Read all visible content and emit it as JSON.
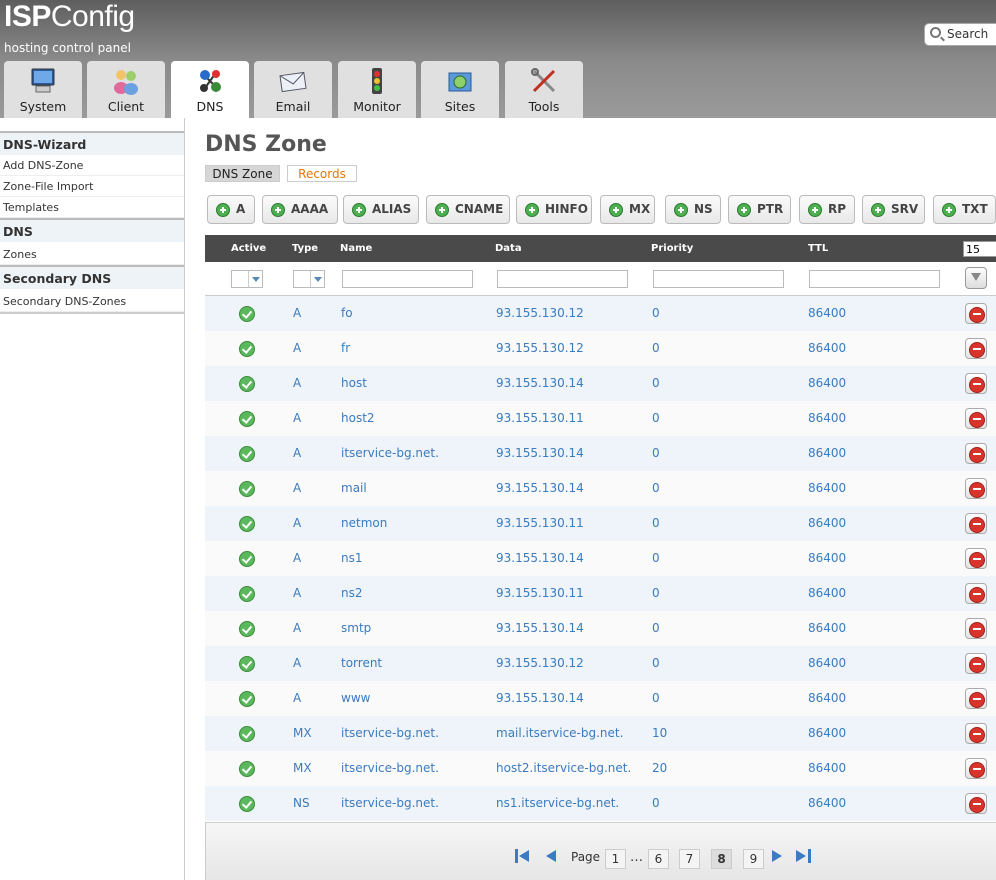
{
  "app": {
    "logo_isp": "ISP",
    "logo_config": "Config",
    "tagline": "hosting control panel",
    "search_label": "Search"
  },
  "tabs": [
    {
      "label": "System",
      "icon": "computer-icon"
    },
    {
      "label": "Client",
      "icon": "users-icon"
    },
    {
      "label": "DNS",
      "icon": "dns-network-icon",
      "active": true
    },
    {
      "label": "Email",
      "icon": "envelope-icon"
    },
    {
      "label": "Monitor",
      "icon": "traffic-light-icon"
    },
    {
      "label": "Sites",
      "icon": "globe-folder-icon"
    },
    {
      "label": "Tools",
      "icon": "tools-icon"
    }
  ],
  "sidebar": {
    "wizard_head": "DNS-Wizard",
    "wizard_items": [
      "Add DNS-Zone",
      "Zone-File Import",
      "Templates"
    ],
    "dns_head": "DNS",
    "dns_items": [
      "Zones"
    ],
    "secondary_head": "Secondary DNS",
    "secondary_items": [
      "Secondary DNS-Zones"
    ]
  },
  "page": {
    "title": "DNS Zone",
    "subtab_zone": "DNS Zone",
    "subtab_records": "Records"
  },
  "add_buttons": [
    "A",
    "AAAA",
    "ALIAS",
    "CNAME",
    "HINFO",
    "MX",
    "NS",
    "PTR",
    "RP",
    "SRV",
    "TXT"
  ],
  "table": {
    "headers": {
      "active": "Active",
      "type": "Type",
      "name": "Name",
      "data": "Data",
      "priority": "Priority",
      "ttl": "TTL"
    },
    "per_page": "15",
    "rows": [
      {
        "type": "A",
        "name": "fo",
        "data": "93.155.130.12",
        "priority": "0",
        "ttl": "86400"
      },
      {
        "type": "A",
        "name": "fr",
        "data": "93.155.130.12",
        "priority": "0",
        "ttl": "86400"
      },
      {
        "type": "A",
        "name": "host",
        "data": "93.155.130.14",
        "priority": "0",
        "ttl": "86400"
      },
      {
        "type": "A",
        "name": "host2",
        "data": "93.155.130.11",
        "priority": "0",
        "ttl": "86400"
      },
      {
        "type": "A",
        "name": "itservice-bg.net.",
        "data": "93.155.130.14",
        "priority": "0",
        "ttl": "86400"
      },
      {
        "type": "A",
        "name": "mail",
        "data": "93.155.130.14",
        "priority": "0",
        "ttl": "86400"
      },
      {
        "type": "A",
        "name": "netmon",
        "data": "93.155.130.11",
        "priority": "0",
        "ttl": "86400"
      },
      {
        "type": "A",
        "name": "ns1",
        "data": "93.155.130.14",
        "priority": "0",
        "ttl": "86400"
      },
      {
        "type": "A",
        "name": "ns2",
        "data": "93.155.130.11",
        "priority": "0",
        "ttl": "86400"
      },
      {
        "type": "A",
        "name": "smtp",
        "data": "93.155.130.14",
        "priority": "0",
        "ttl": "86400"
      },
      {
        "type": "A",
        "name": "torrent",
        "data": "93.155.130.12",
        "priority": "0",
        "ttl": "86400"
      },
      {
        "type": "A",
        "name": "www",
        "data": "93.155.130.14",
        "priority": "0",
        "ttl": "86400"
      },
      {
        "type": "MX",
        "name": "itservice-bg.net.",
        "data": "mail.itservice-bg.net.",
        "priority": "10",
        "ttl": "86400"
      },
      {
        "type": "MX",
        "name": "itservice-bg.net.",
        "data": "host2.itservice-bg.net.",
        "priority": "20",
        "ttl": "86400"
      },
      {
        "type": "NS",
        "name": "itservice-bg.net.",
        "data": "ns1.itservice-bg.net.",
        "priority": "0",
        "ttl": "86400"
      }
    ]
  },
  "pager": {
    "label": "Page",
    "pages": [
      "1",
      "6",
      "7",
      "8",
      "9"
    ],
    "current": "8",
    "ellipsis": "…"
  },
  "colors": {
    "link": "#3b7bbf",
    "records_tab": "#e07800",
    "header_bar": "#4a4a4a"
  }
}
